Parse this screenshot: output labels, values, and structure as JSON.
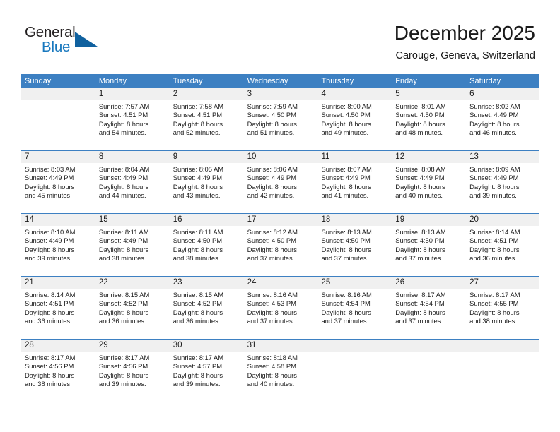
{
  "brand": {
    "name_part1": "General",
    "name_part2": "Blue",
    "triangle_color": "#10619f",
    "blue_color": "#1878be"
  },
  "header": {
    "title": "December 2025",
    "subtitle": "Carouge, Geneva, Switzerland"
  },
  "theme": {
    "header_row_bg": "#3d80c2",
    "day_number_band_bg": "#f0f0f0",
    "grid_line": "#3d80c2"
  },
  "weekdays": [
    "Sunday",
    "Monday",
    "Tuesday",
    "Wednesday",
    "Thursday",
    "Friday",
    "Saturday"
  ],
  "weeks": [
    [
      {
        "day": "",
        "sunrise": "",
        "sunset": "",
        "daylight_line1": "",
        "daylight_line2": ""
      },
      {
        "day": "1",
        "sunrise": "Sunrise: 7:57 AM",
        "sunset": "Sunset: 4:51 PM",
        "daylight_line1": "Daylight: 8 hours",
        "daylight_line2": "and 54 minutes."
      },
      {
        "day": "2",
        "sunrise": "Sunrise: 7:58 AM",
        "sunset": "Sunset: 4:51 PM",
        "daylight_line1": "Daylight: 8 hours",
        "daylight_line2": "and 52 minutes."
      },
      {
        "day": "3",
        "sunrise": "Sunrise: 7:59 AM",
        "sunset": "Sunset: 4:50 PM",
        "daylight_line1": "Daylight: 8 hours",
        "daylight_line2": "and 51 minutes."
      },
      {
        "day": "4",
        "sunrise": "Sunrise: 8:00 AM",
        "sunset": "Sunset: 4:50 PM",
        "daylight_line1": "Daylight: 8 hours",
        "daylight_line2": "and 49 minutes."
      },
      {
        "day": "5",
        "sunrise": "Sunrise: 8:01 AM",
        "sunset": "Sunset: 4:50 PM",
        "daylight_line1": "Daylight: 8 hours",
        "daylight_line2": "and 48 minutes."
      },
      {
        "day": "6",
        "sunrise": "Sunrise: 8:02 AM",
        "sunset": "Sunset: 4:49 PM",
        "daylight_line1": "Daylight: 8 hours",
        "daylight_line2": "and 46 minutes."
      }
    ],
    [
      {
        "day": "7",
        "sunrise": "Sunrise: 8:03 AM",
        "sunset": "Sunset: 4:49 PM",
        "daylight_line1": "Daylight: 8 hours",
        "daylight_line2": "and 45 minutes."
      },
      {
        "day": "8",
        "sunrise": "Sunrise: 8:04 AM",
        "sunset": "Sunset: 4:49 PM",
        "daylight_line1": "Daylight: 8 hours",
        "daylight_line2": "and 44 minutes."
      },
      {
        "day": "9",
        "sunrise": "Sunrise: 8:05 AM",
        "sunset": "Sunset: 4:49 PM",
        "daylight_line1": "Daylight: 8 hours",
        "daylight_line2": "and 43 minutes."
      },
      {
        "day": "10",
        "sunrise": "Sunrise: 8:06 AM",
        "sunset": "Sunset: 4:49 PM",
        "daylight_line1": "Daylight: 8 hours",
        "daylight_line2": "and 42 minutes."
      },
      {
        "day": "11",
        "sunrise": "Sunrise: 8:07 AM",
        "sunset": "Sunset: 4:49 PM",
        "daylight_line1": "Daylight: 8 hours",
        "daylight_line2": "and 41 minutes."
      },
      {
        "day": "12",
        "sunrise": "Sunrise: 8:08 AM",
        "sunset": "Sunset: 4:49 PM",
        "daylight_line1": "Daylight: 8 hours",
        "daylight_line2": "and 40 minutes."
      },
      {
        "day": "13",
        "sunrise": "Sunrise: 8:09 AM",
        "sunset": "Sunset: 4:49 PM",
        "daylight_line1": "Daylight: 8 hours",
        "daylight_line2": "and 39 minutes."
      }
    ],
    [
      {
        "day": "14",
        "sunrise": "Sunrise: 8:10 AM",
        "sunset": "Sunset: 4:49 PM",
        "daylight_line1": "Daylight: 8 hours",
        "daylight_line2": "and 39 minutes."
      },
      {
        "day": "15",
        "sunrise": "Sunrise: 8:11 AM",
        "sunset": "Sunset: 4:49 PM",
        "daylight_line1": "Daylight: 8 hours",
        "daylight_line2": "and 38 minutes."
      },
      {
        "day": "16",
        "sunrise": "Sunrise: 8:11 AM",
        "sunset": "Sunset: 4:50 PM",
        "daylight_line1": "Daylight: 8 hours",
        "daylight_line2": "and 38 minutes."
      },
      {
        "day": "17",
        "sunrise": "Sunrise: 8:12 AM",
        "sunset": "Sunset: 4:50 PM",
        "daylight_line1": "Daylight: 8 hours",
        "daylight_line2": "and 37 minutes."
      },
      {
        "day": "18",
        "sunrise": "Sunrise: 8:13 AM",
        "sunset": "Sunset: 4:50 PM",
        "daylight_line1": "Daylight: 8 hours",
        "daylight_line2": "and 37 minutes."
      },
      {
        "day": "19",
        "sunrise": "Sunrise: 8:13 AM",
        "sunset": "Sunset: 4:50 PM",
        "daylight_line1": "Daylight: 8 hours",
        "daylight_line2": "and 37 minutes."
      },
      {
        "day": "20",
        "sunrise": "Sunrise: 8:14 AM",
        "sunset": "Sunset: 4:51 PM",
        "daylight_line1": "Daylight: 8 hours",
        "daylight_line2": "and 36 minutes."
      }
    ],
    [
      {
        "day": "21",
        "sunrise": "Sunrise: 8:14 AM",
        "sunset": "Sunset: 4:51 PM",
        "daylight_line1": "Daylight: 8 hours",
        "daylight_line2": "and 36 minutes."
      },
      {
        "day": "22",
        "sunrise": "Sunrise: 8:15 AM",
        "sunset": "Sunset: 4:52 PM",
        "daylight_line1": "Daylight: 8 hours",
        "daylight_line2": "and 36 minutes."
      },
      {
        "day": "23",
        "sunrise": "Sunrise: 8:15 AM",
        "sunset": "Sunset: 4:52 PM",
        "daylight_line1": "Daylight: 8 hours",
        "daylight_line2": "and 36 minutes."
      },
      {
        "day": "24",
        "sunrise": "Sunrise: 8:16 AM",
        "sunset": "Sunset: 4:53 PM",
        "daylight_line1": "Daylight: 8 hours",
        "daylight_line2": "and 37 minutes."
      },
      {
        "day": "25",
        "sunrise": "Sunrise: 8:16 AM",
        "sunset": "Sunset: 4:54 PM",
        "daylight_line1": "Daylight: 8 hours",
        "daylight_line2": "and 37 minutes."
      },
      {
        "day": "26",
        "sunrise": "Sunrise: 8:17 AM",
        "sunset": "Sunset: 4:54 PM",
        "daylight_line1": "Daylight: 8 hours",
        "daylight_line2": "and 37 minutes."
      },
      {
        "day": "27",
        "sunrise": "Sunrise: 8:17 AM",
        "sunset": "Sunset: 4:55 PM",
        "daylight_line1": "Daylight: 8 hours",
        "daylight_line2": "and 38 minutes."
      }
    ],
    [
      {
        "day": "28",
        "sunrise": "Sunrise: 8:17 AM",
        "sunset": "Sunset: 4:56 PM",
        "daylight_line1": "Daylight: 8 hours",
        "daylight_line2": "and 38 minutes."
      },
      {
        "day": "29",
        "sunrise": "Sunrise: 8:17 AM",
        "sunset": "Sunset: 4:56 PM",
        "daylight_line1": "Daylight: 8 hours",
        "daylight_line2": "and 39 minutes."
      },
      {
        "day": "30",
        "sunrise": "Sunrise: 8:17 AM",
        "sunset": "Sunset: 4:57 PM",
        "daylight_line1": "Daylight: 8 hours",
        "daylight_line2": "and 39 minutes."
      },
      {
        "day": "31",
        "sunrise": "Sunrise: 8:18 AM",
        "sunset": "Sunset: 4:58 PM",
        "daylight_line1": "Daylight: 8 hours",
        "daylight_line2": "and 40 minutes."
      },
      {
        "day": "",
        "sunrise": "",
        "sunset": "",
        "daylight_line1": "",
        "daylight_line2": ""
      },
      {
        "day": "",
        "sunrise": "",
        "sunset": "",
        "daylight_line1": "",
        "daylight_line2": ""
      },
      {
        "day": "",
        "sunrise": "",
        "sunset": "",
        "daylight_line1": "",
        "daylight_line2": ""
      }
    ]
  ]
}
